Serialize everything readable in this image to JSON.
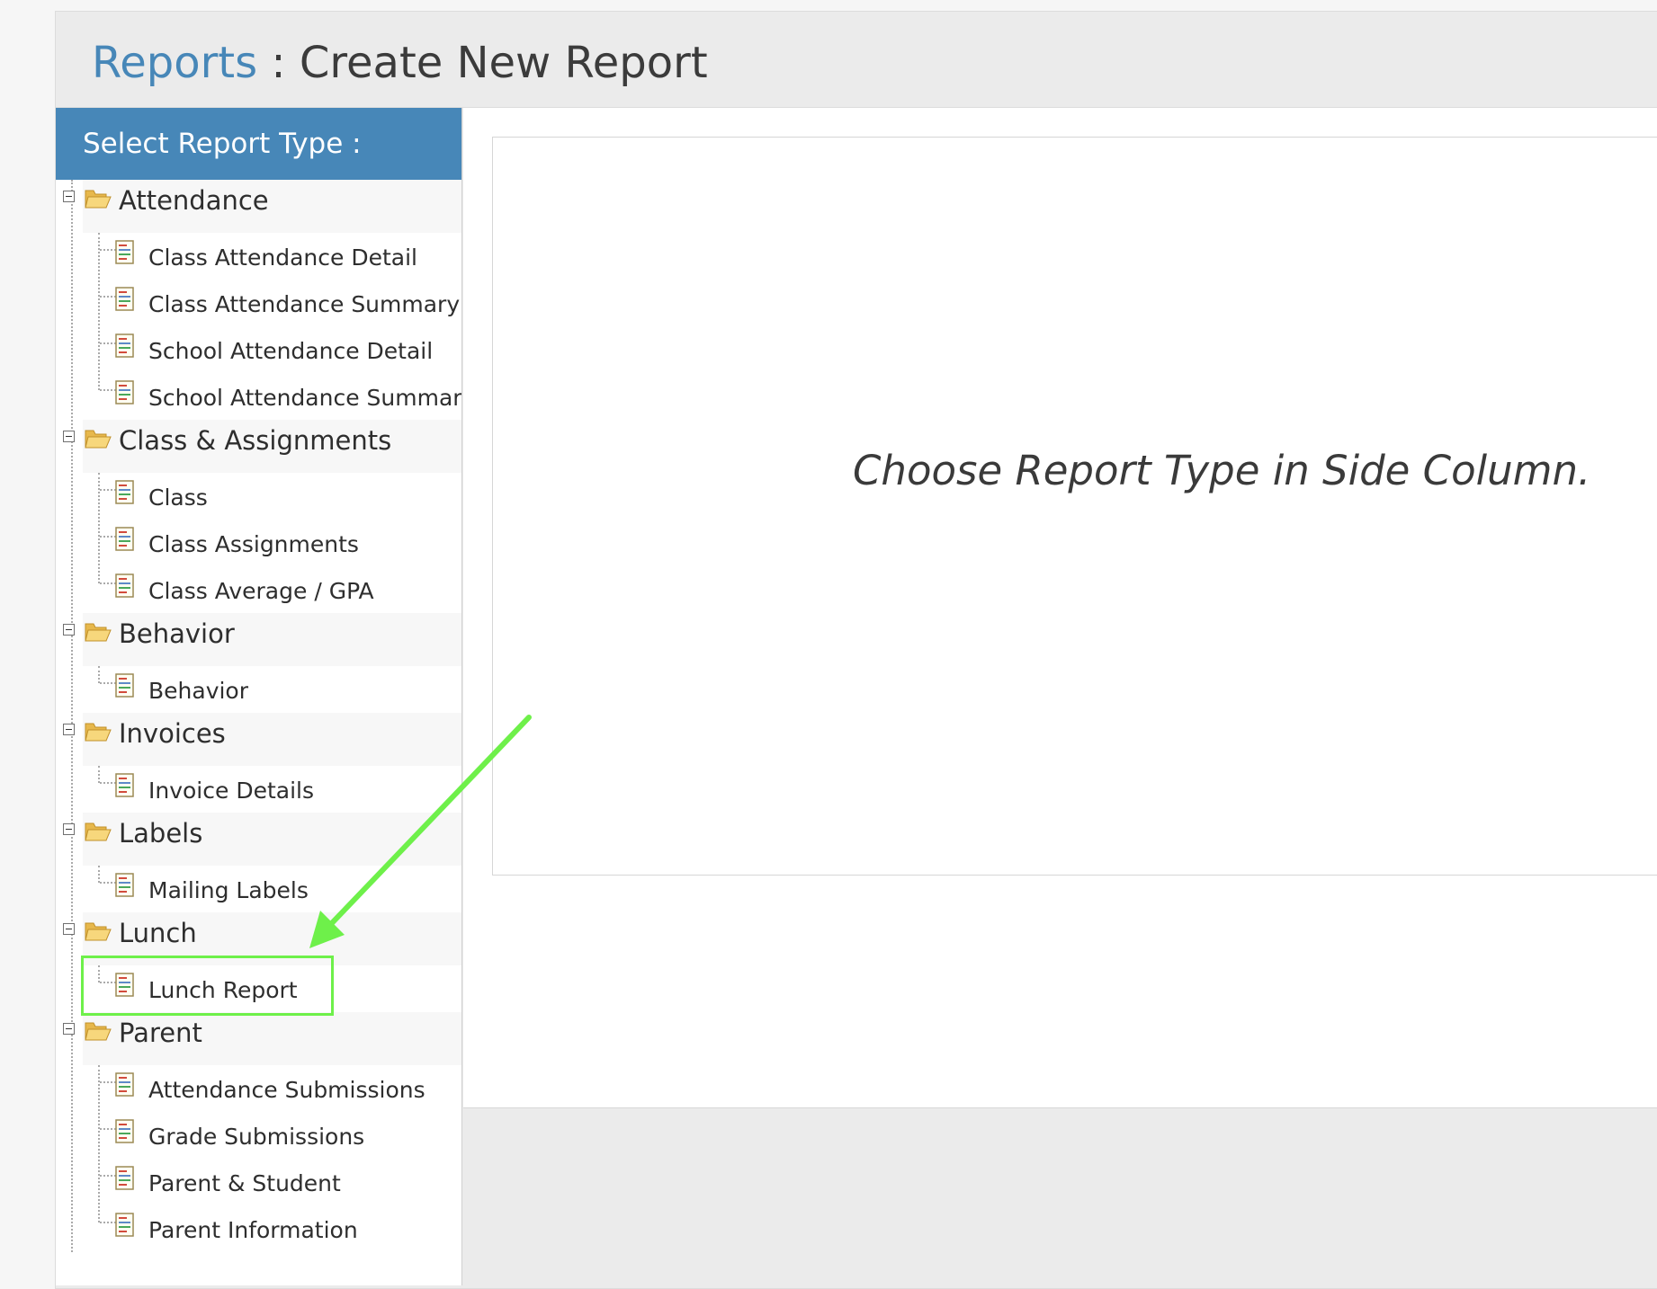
{
  "header": {
    "breadcrumb_link": "Reports",
    "separator": " : ",
    "title": "Create New Report"
  },
  "sidebar": {
    "heading": "Select Report Type :",
    "categories": [
      {
        "label": "Attendance",
        "reports": [
          "Class Attendance Detail",
          "Class Attendance Summary",
          "School Attendance Detail",
          "School Attendance Summary"
        ]
      },
      {
        "label": "Class & Assignments",
        "reports": [
          "Class",
          "Class Assignments",
          "Class Average / GPA"
        ]
      },
      {
        "label": "Behavior",
        "reports": [
          "Behavior"
        ]
      },
      {
        "label": "Invoices",
        "reports": [
          "Invoice Details"
        ]
      },
      {
        "label": "Labels",
        "reports": [
          "Mailing Labels"
        ]
      },
      {
        "label": "Lunch",
        "reports": [
          "Lunch Report"
        ]
      },
      {
        "label": "Parent",
        "reports": [
          "Attendance Submissions",
          "Grade Submissions",
          "Parent & Student",
          "Parent Information"
        ]
      }
    ]
  },
  "main": {
    "placeholder": "Choose Report Type in Side Column."
  },
  "annotation": {
    "highlighted_item": "Lunch Report",
    "arrow_color": "#6ef04a"
  },
  "colors": {
    "accent": "#4787b8",
    "header_bg": "#ebebeb",
    "annotation": "#6ef04a"
  },
  "icons": {
    "category": "folder-open-icon",
    "report": "report-document-icon",
    "toggle": "collapse-minus-icon"
  }
}
